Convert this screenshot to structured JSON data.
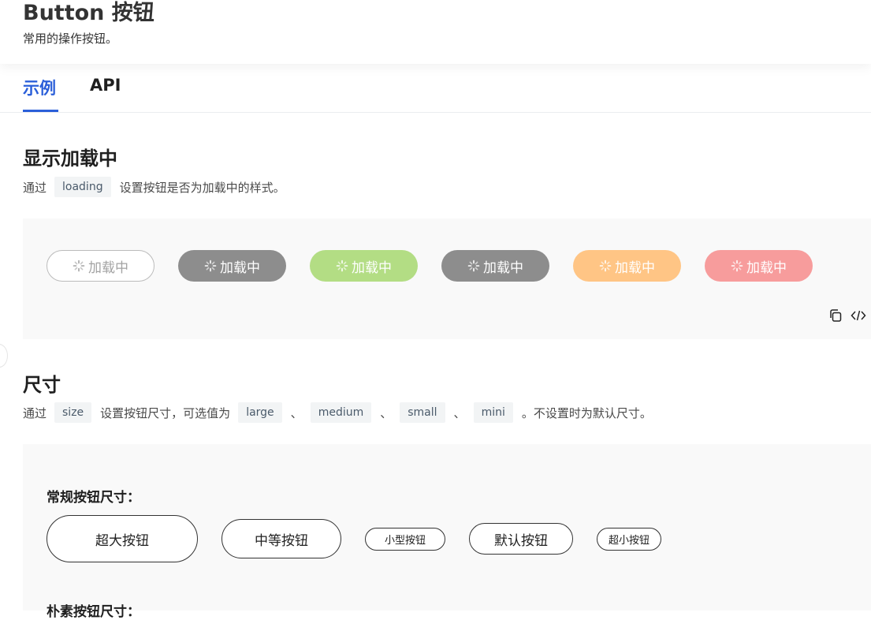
{
  "header": {
    "title": "Button 按钮",
    "subtitle": "常用的操作按钮。"
  },
  "tabs": [
    {
      "label": "示例",
      "active": true
    },
    {
      "label": "API",
      "active": false
    }
  ],
  "colors": {
    "accent": "#2b5fd9",
    "btn_default_border": "#bbbbbb",
    "btn_default_text": "#a3a3a3",
    "btn_gray": "#8d8d8d",
    "btn_green": "#b3dd84",
    "btn_orange": "#ffc585",
    "btn_red": "#f79c9c"
  },
  "loading_section": {
    "title": "显示加载中",
    "desc_prefix": "通过",
    "desc_code": "loading",
    "desc_suffix": "设置按钮是否为加载中的样式。",
    "spinner_icon": "loading-spinner-icon",
    "buttons": [
      {
        "label": "加载中",
        "variant": "default"
      },
      {
        "label": "加载中",
        "variant": "primary"
      },
      {
        "label": "加载中",
        "variant": "success"
      },
      {
        "label": "加载中",
        "variant": "info"
      },
      {
        "label": "加载中",
        "variant": "warning"
      },
      {
        "label": "加载中",
        "variant": "danger"
      }
    ],
    "tools": [
      "copy-icon",
      "code-icon"
    ]
  },
  "size_section": {
    "title": "尺寸",
    "desc_prefix": "通过",
    "desc_code_size": "size",
    "desc_middle": "设置按钮尺寸，可选值为",
    "code_large": "large",
    "code_medium": "medium",
    "code_small": "small",
    "code_mini": "mini",
    "sep": "、",
    "desc_suffix": "。不设置时为默认尺寸。",
    "normal_title": "常规按钮尺寸：",
    "normal_buttons": [
      {
        "label": "超大按钮"
      },
      {
        "label": "中等按钮"
      },
      {
        "label": "小型按钮"
      },
      {
        "label": "默认按钮"
      },
      {
        "label": "超小按钮"
      }
    ],
    "plain_title": "朴素按钮尺寸："
  }
}
